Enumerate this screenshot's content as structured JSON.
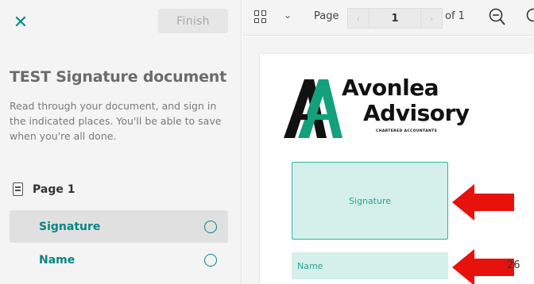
{
  "sidebar": {
    "close_glyph": "✕",
    "finish_label": "Finish",
    "title": "TEST Signature document",
    "description": "Read through your document, and sign in the indicated places. You'll be able to save when you're all done.",
    "page_label": "Page 1",
    "fields": [
      {
        "label": "Signature",
        "selected": true
      },
      {
        "label": "Name",
        "selected": false
      }
    ]
  },
  "toolbar": {
    "page_label": "Page",
    "current_page": "1",
    "of_label": "of 1",
    "prev_glyph": "‹",
    "next_glyph": "›",
    "dropdown_glyph": "⌄"
  },
  "document": {
    "logo_line1": "Avonlea",
    "logo_line2": "Advisory",
    "logo_tagline": "CHARTERED ACCOUNTANTS",
    "signature_field_label": "Signature",
    "name_field_label": "Name",
    "truncated_text": "26"
  },
  "colors": {
    "accent": "#0b8383",
    "field_fill": "#d5efea",
    "arrow": "#e8120c",
    "logo_green": "#14a07d"
  },
  "icons": [
    "close-icon",
    "grid-view-icon",
    "chevron-down-icon",
    "zoom-out-icon",
    "zoom-in-icon",
    "page-icon",
    "status-circle-icon",
    "arrow-icon"
  ]
}
